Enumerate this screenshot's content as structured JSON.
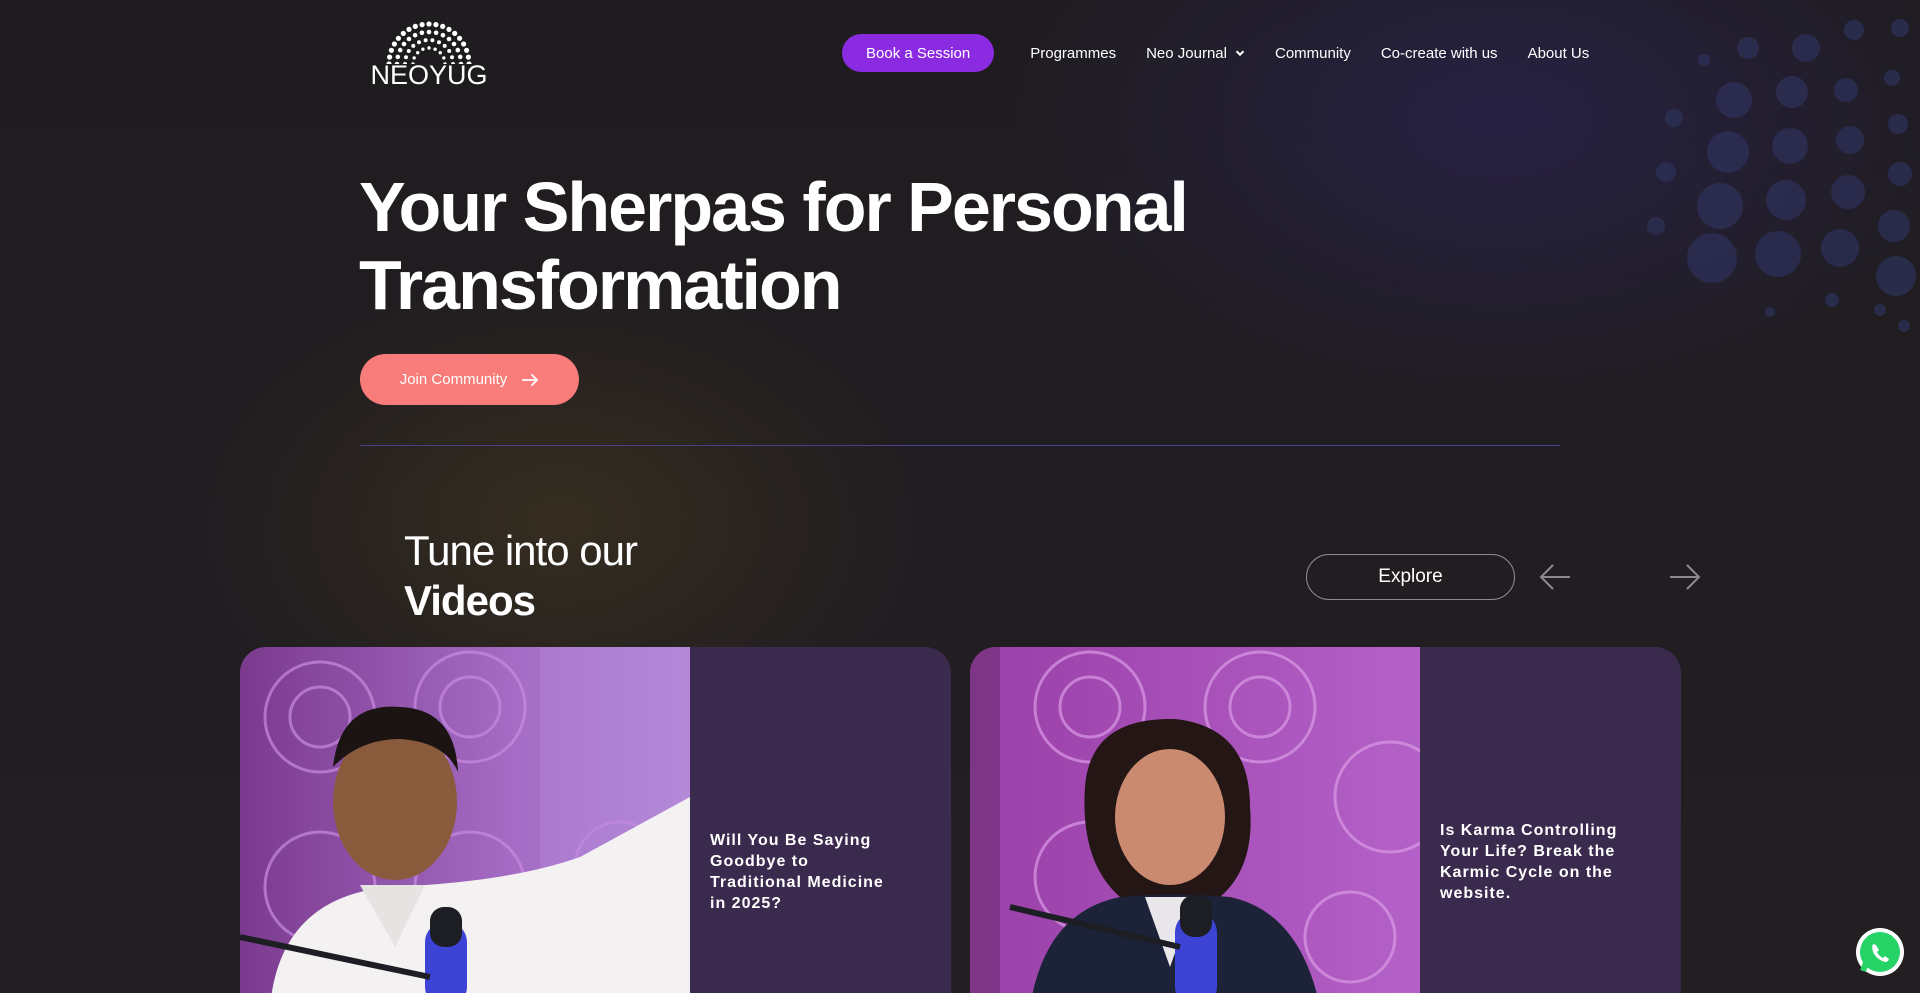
{
  "header": {
    "logo_text": "NEOYUG",
    "book_button": "Book a Session",
    "nav": [
      "Programmes",
      "Neo Journal",
      "Community",
      "Co-create with us",
      "About Us"
    ]
  },
  "hero": {
    "title_light": "Your Sherpas for ",
    "title_bold": "Personal Transformation",
    "join_button": "Join Community"
  },
  "videos": {
    "heading_light": "Tune into our",
    "heading_bold": "Videos",
    "explore_button": "Explore",
    "cards": [
      {
        "title": "Will You Be Saying Goodbye to Traditional Medicine in 2025?"
      },
      {
        "title": "Is Karma Controlling Your Life? Break the Karmic Cycle on the website."
      }
    ]
  },
  "colors": {
    "accent_purple": "#8a2be2",
    "accent_coral": "#f87d7a",
    "card_bg": "#3a2a4d",
    "page_bg": "#1e1b1f"
  },
  "icons": [
    "chevron-down-icon",
    "arrow-right-icon",
    "arrow-left-icon",
    "whatsapp-icon"
  ]
}
